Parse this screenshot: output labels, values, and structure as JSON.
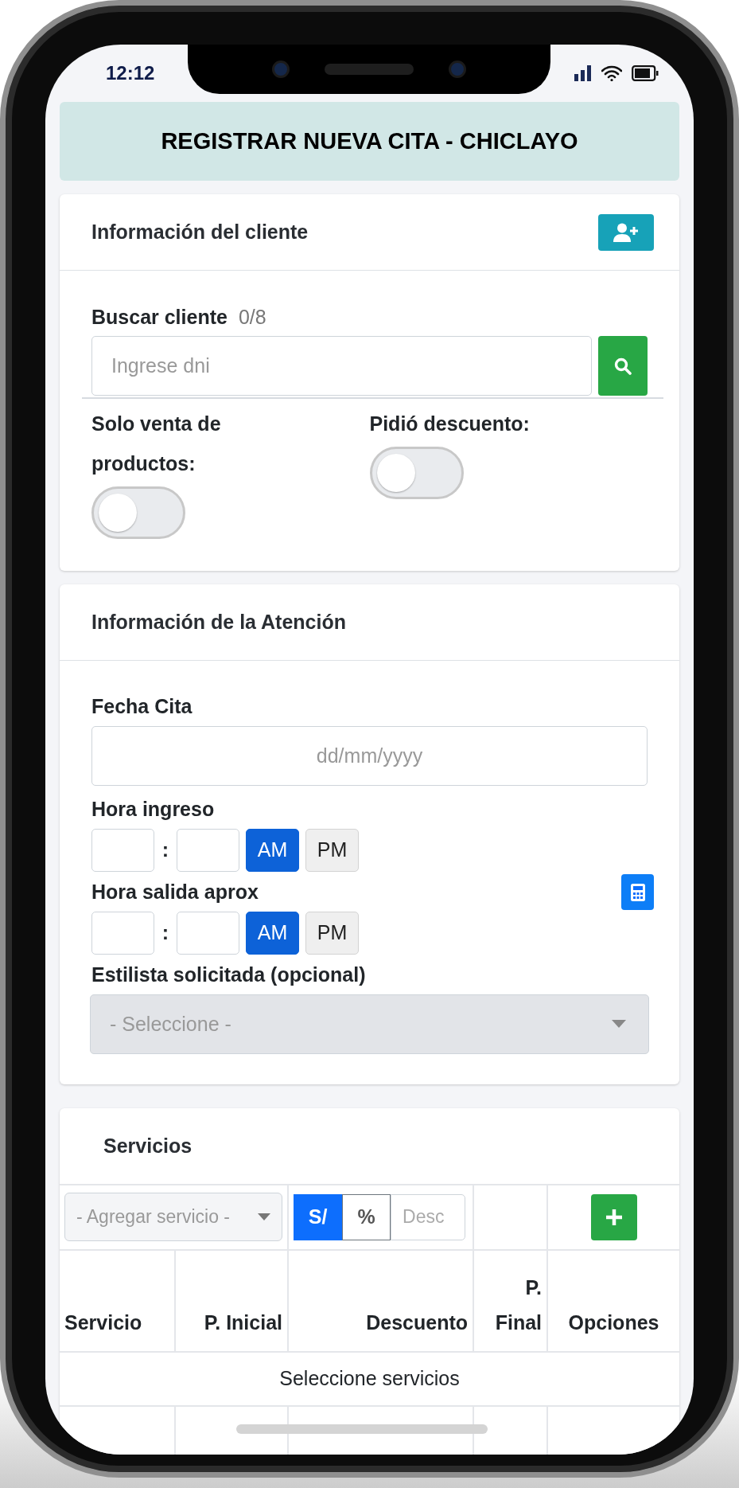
{
  "status_bar": {
    "time": "12:12"
  },
  "page_title": "REGISTRAR NUEVA CITA - CHICLAYO",
  "client_card": {
    "title": "Información del cliente",
    "search": {
      "label": "Buscar cliente",
      "counter": "0/8",
      "placeholder": "Ingrese dni"
    },
    "toggles": [
      {
        "label": "Solo venta de productos:",
        "on": false
      },
      {
        "label": "Pidió descuento:",
        "on": false
      }
    ]
  },
  "attention_card": {
    "title": "Información de la Atención",
    "date": {
      "label": "Fecha Cita",
      "placeholder": "dd/mm/yyyy"
    },
    "times": [
      {
        "label": "Hora ingreso",
        "separator": ":",
        "calculator": false,
        "periods": [
          {
            "label": "AM",
            "selected": true
          },
          {
            "label": "PM",
            "selected": false
          }
        ]
      },
      {
        "label": "Hora salida aprox",
        "separator": ":",
        "calculator": true,
        "periods": [
          {
            "label": "AM",
            "selected": true
          },
          {
            "label": "PM",
            "selected": false
          }
        ]
      }
    ],
    "stylist": {
      "label": "Estilista solicitada (opcional)",
      "placeholder": "- Seleccione -",
      "disabled": true
    }
  },
  "services_card": {
    "title": "Servicios",
    "service_select": "- Agregar servicio -",
    "discount_modes": [
      {
        "label": "S/",
        "selected": true
      },
      {
        "label": "%",
        "selected": false
      }
    ],
    "discount_placeholder": "Desc",
    "columns": [
      "Servicio",
      "P. Inicial",
      "Descuento",
      "P. Final",
      "Opciones"
    ],
    "empty_text": "Seleccione servicios"
  }
}
